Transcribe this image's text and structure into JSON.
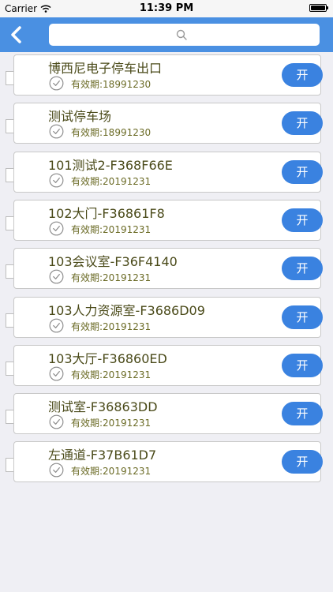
{
  "status_bar": {
    "carrier": "Carrier",
    "time": "11:39 PM"
  },
  "nav": {
    "search_placeholder": "",
    "back_icon": "chevron-left-icon",
    "search_icon": "search-icon"
  },
  "theme": {
    "nav_color": "#4a90e2",
    "button_color": "#3a82e0",
    "title_color": "#4a4a19"
  },
  "items": [
    {
      "name": "博西尼电子停车出口",
      "validity": "有效期:18991230",
      "button": "开"
    },
    {
      "name": "测试停车场",
      "validity": "有效期:18991230",
      "button": "开"
    },
    {
      "name": "101测试2-F368F66E",
      "validity": "有效期:20191231",
      "button": "开"
    },
    {
      "name": "102大门-F36861F8",
      "validity": "有效期:20191231",
      "button": "开"
    },
    {
      "name": "103会议室-F36F4140",
      "validity": "有效期:20191231",
      "button": "开"
    },
    {
      "name": "103人力资源室-F3686D09",
      "validity": "有效期:20191231",
      "button": "开"
    },
    {
      "name": "103大厅-F36860ED",
      "validity": "有效期:20191231",
      "button": "开"
    },
    {
      "name": "测试室-F36863DD",
      "validity": "有效期:20191231",
      "button": "开"
    },
    {
      "name": "左通道-F37B61D7",
      "validity": "有效期:20191231",
      "button": "开"
    }
  ]
}
